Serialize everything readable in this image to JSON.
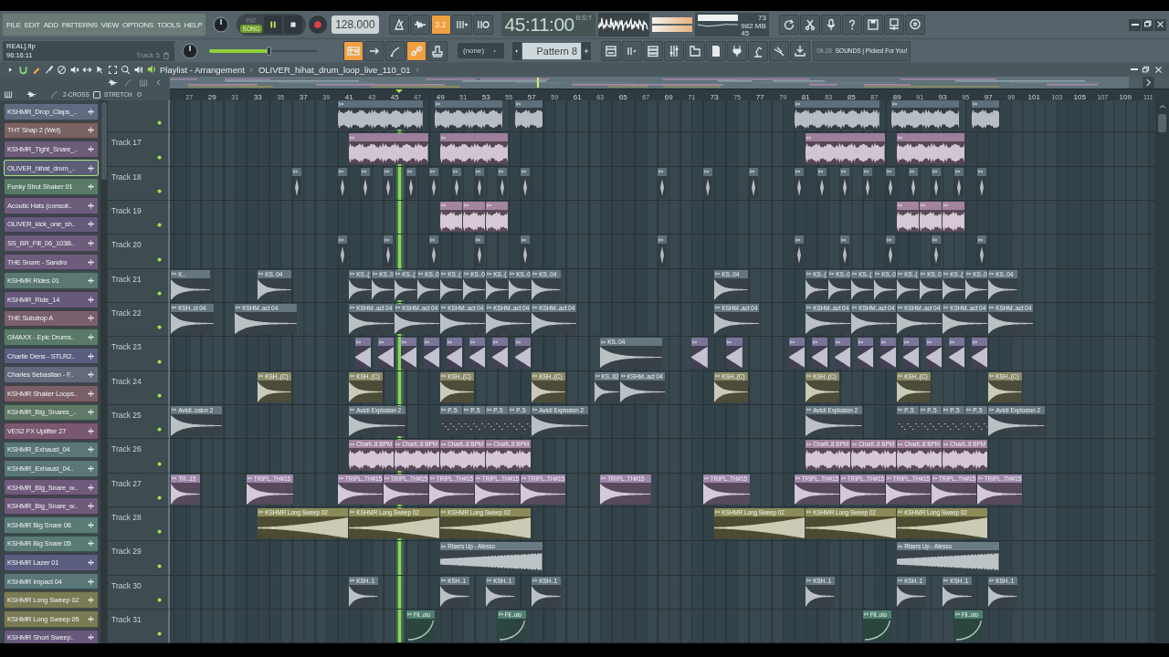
{
  "menu": [
    "FILE",
    "EDIT",
    "ADD",
    "PATTERNS",
    "VIEW",
    "OPTIONS",
    "TOOLS",
    "HELP"
  ],
  "modes": [
    {
      "label": "PAT",
      "selected": false
    },
    {
      "label": "SONG",
      "selected": true
    }
  ],
  "transport": {
    "playing": true
  },
  "tempo": "128.000",
  "tools_top": [
    {
      "kind": "metronome",
      "on": false
    },
    {
      "kind": "wave",
      "on": false
    },
    {
      "kind": "text",
      "label": "3.2",
      "on": true
    },
    {
      "kind": "step",
      "on": false
    },
    {
      "kind": "loop",
      "on": false
    }
  ],
  "time": {
    "value": "45:11:00",
    "unit": "B:S:T"
  },
  "stats": {
    "cpu": "73",
    "memory": "982 MB",
    "polyphony": "45"
  },
  "file": {
    "name": "REAL].flp",
    "time": "96:16:11",
    "hint": "Track 5"
  },
  "master": {
    "level": 0.55
  },
  "tools_bottom": [
    {
      "kind": "playlist",
      "on": true
    },
    {
      "kind": "arrow",
      "on": false
    },
    {
      "kind": "curve",
      "on": false
    },
    {
      "kind": "link",
      "on": true
    },
    {
      "kind": "stamp",
      "on": false
    }
  ],
  "arrangement": "(none)",
  "pattern": "Pattern 8",
  "news": {
    "date": "09-28",
    "text": "SOUNDS | Picked For You!"
  },
  "playlist": {
    "title": "Playlist - Arrangement",
    "clip": "OLIVER_hihat_drum_loop_live_110_01",
    "cross": "2-CROSS",
    "cross_checked": false,
    "stretch": "STRETCH"
  },
  "ruler": [
    "27",
    "29",
    "31",
    "33",
    "35",
    "37",
    "39",
    "41",
    "43",
    "45",
    "47",
    "49",
    "51",
    "53",
    "55",
    "57",
    "59",
    "61",
    "63",
    "65",
    "67",
    "69",
    "71",
    "73",
    "75",
    "77",
    "79",
    "81",
    "83",
    "85",
    "87",
    "89",
    "91",
    "93",
    "95",
    "97",
    "99",
    "101",
    "103",
    "105",
    "107",
    "109",
    "111"
  ],
  "channels": [
    {
      "name": "KSHMR_Drop_Claps_..",
      "color": "#5e6b80",
      "selected": false
    },
    {
      "name": "THT Snap 2 (Wet)",
      "color": "#7b6262",
      "selected": false
    },
    {
      "name": "KSHMR_Tight_Snare_..",
      "color": "#6b5c78",
      "selected": false
    },
    {
      "name": "OLIVER_hihat_drum_..",
      "color": "#5c5e78",
      "selected": true
    },
    {
      "name": "Funky Strut Shaker 01",
      "color": "#587a67",
      "selected": false
    },
    {
      "name": "Acoutic Hats (consoli..",
      "color": "#6d5c7c",
      "selected": false
    },
    {
      "name": "OLIVER_kick_one_sh..",
      "color": "#665a7c",
      "selected": false
    },
    {
      "name": "SS_BR_Fill_06_103B..",
      "color": "#6d5c7c",
      "selected": false
    },
    {
      "name": "THE Snare - Sandro",
      "color": "#6d5c7c",
      "selected": false
    },
    {
      "name": "KSHMR Rides 01",
      "color": "#5a7770",
      "selected": false
    },
    {
      "name": "KSHMR_Ride_14",
      "color": "#66597a",
      "selected": false
    },
    {
      "name": "THE Subdrop A",
      "color": "#7a5f6c",
      "selected": false
    },
    {
      "name": "GMAXX - Epic Drums..",
      "color": "#587a67",
      "selected": false
    },
    {
      "name": "Charlie Dens - STLR2..",
      "color": "#5c5e80",
      "selected": false
    },
    {
      "name": "Charles Sebastian - F..",
      "color": "#626a7c",
      "selected": false
    },
    {
      "name": "KSHMR Shaker Loops..",
      "color": "#7a5f66",
      "selected": false
    },
    {
      "name": "KSHMR_Big_Snares_..",
      "color": "#5f7a66",
      "selected": false
    },
    {
      "name": "VES2 FX Uplifter 27",
      "color": "#7a5870",
      "selected": false
    },
    {
      "name": "KSHMR_Exhaust_04",
      "color": "#5a7676",
      "selected": false
    },
    {
      "name": "KSHMR_Exhaust_04..",
      "color": "#5a7676",
      "selected": false
    },
    {
      "name": "KSHMR_Big_Snare_w..",
      "color": "#6f5a7c",
      "selected": false
    },
    {
      "name": "KSHMR_Big_Snare_w..",
      "color": "#6f5a7c",
      "selected": false
    },
    {
      "name": "KSHMR Big Snare 06",
      "color": "#5a7a76",
      "selected": false
    },
    {
      "name": "KSHMR Big Snare 05",
      "color": "#5a7a76",
      "selected": false
    },
    {
      "name": "KSHMR Lazer 01",
      "color": "#5c5e80",
      "selected": false
    },
    {
      "name": "KSHMR Impact 04",
      "color": "#5a7676",
      "selected": false
    },
    {
      "name": "KSHMR Long Sweep 02",
      "color": "#7a7a55",
      "selected": false
    },
    {
      "name": "KSHMR Long Sweep 05",
      "color": "#7a7a55",
      "selected": false
    },
    {
      "name": "KSHMR Short Sweep..",
      "color": "#66597a",
      "selected": false
    }
  ],
  "tracks": [
    {
      "active": true,
      "clips": [
        {
          "kind": "loop"
        },
        {
          "kind": "loop"
        },
        {
          "kind": "loop"
        },
        {
          "kind": "loop"
        },
        {
          "kind": "loop"
        },
        {
          "kind": "loop"
        }
      ]
    },
    {
      "label": "Track 17",
      "active": true,
      "color": "#9c7f9a",
      "clips": [
        {
          "kind": "loop"
        },
        {
          "kind": "loop"
        },
        {
          "kind": "loop"
        },
        {
          "kind": "loop"
        }
      ]
    },
    {
      "label": "Track 18",
      "active": true,
      "color": "#5f6f79",
      "clips": [
        {
          "kind": "tick"
        },
        {
          "kind": "tick"
        },
        {
          "kind": "tick"
        },
        {
          "kind": "tick"
        },
        {
          "kind": "tick"
        },
        {
          "kind": "tick"
        },
        {
          "kind": "tick"
        },
        {
          "kind": "tick"
        },
        {
          "kind": "tick"
        },
        {
          "kind": "tick"
        },
        {
          "kind": "tick"
        },
        {
          "kind": "tick"
        },
        {
          "kind": "tick"
        },
        {
          "kind": "tick"
        },
        {
          "kind": "tick"
        },
        {
          "kind": "tick"
        },
        {
          "kind": "tick"
        },
        {
          "kind": "tick"
        },
        {
          "kind": "tick"
        },
        {
          "kind": "tick"
        },
        {
          "kind": "tick"
        },
        {
          "kind": "tick"
        }
      ]
    },
    {
      "label": "Track 19",
      "active": true,
      "color": "#a4849f",
      "clips": [
        {
          "kind": "loop"
        },
        {
          "kind": "loop"
        },
        {
          "kind": "loop"
        },
        {
          "kind": "loop"
        },
        {
          "kind": "loop"
        },
        {
          "kind": "loop"
        }
      ]
    },
    {
      "label": "Track 20",
      "active": true,
      "color": "#5f6f79",
      "clips": [
        {
          "kind": "tick"
        },
        {
          "kind": "tick"
        },
        {
          "kind": "tick"
        },
        {
          "kind": "tick"
        },
        {
          "kind": "tick"
        },
        {
          "kind": "tick"
        },
        {
          "kind": "tick"
        },
        {
          "kind": "tick"
        },
        {
          "kind": "tick"
        },
        {
          "kind": "tick"
        },
        {
          "kind": "tick"
        }
      ]
    },
    {
      "label": "Track 21",
      "active": true,
      "color": "#66767f",
      "clips": [
        {
          "kind": "hit",
          "label": "K.."
        },
        {
          "kind": "hit",
          "label": "KS..04"
        },
        {
          "kind": "hit",
          "label": "KS..("
        },
        {
          "kind": "hit",
          "label": "KS..0"
        },
        {
          "kind": "hit",
          "label": "KS..("
        },
        {
          "kind": "hit",
          "label": "KS..0"
        },
        {
          "kind": "hit",
          "label": "KS..("
        },
        {
          "kind": "hit",
          "label": "KS..0"
        },
        {
          "kind": "hit",
          "label": "KS..("
        },
        {
          "kind": "hit",
          "label": "KS..0"
        },
        {
          "kind": "hit",
          "label": "KS..04"
        },
        {
          "kind": "hit",
          "label": "KS..04"
        },
        {
          "kind": "hit",
          "label": "KS..("
        },
        {
          "kind": "hit",
          "label": "KS..0"
        },
        {
          "kind": "hit",
          "label": "KS..("
        },
        {
          "kind": "hit",
          "label": "KS..0"
        },
        {
          "kind": "hit",
          "label": "KS..("
        },
        {
          "kind": "hit",
          "label": "KS..0"
        },
        {
          "kind": "hit",
          "label": "KS..("
        },
        {
          "kind": "hit",
          "label": "KS..0"
        },
        {
          "kind": "hit",
          "label": "KS..04"
        }
      ]
    },
    {
      "label": "Track 22",
      "active": true,
      "color": "#66767f",
      "clips": [
        {
          "kind": "hit",
          "label": "KSH..ct 04"
        },
        {
          "kind": "hit",
          "label": "KSHM..act 04"
        },
        {
          "kind": "hit",
          "label": "KSHM..act 04"
        },
        {
          "kind": "hit",
          "label": "KSHM..act 04"
        },
        {
          "kind": "hit",
          "label": "KSHM..act 04"
        },
        {
          "kind": "hit",
          "label": "KSHM..act 04"
        },
        {
          "kind": "hit",
          "label": "KSHM..act 04"
        },
        {
          "kind": "hit",
          "label": "KSHM..act 04"
        },
        {
          "kind": "hit",
          "label": "KSHM..act 04"
        },
        {
          "kind": "hit",
          "label": "KSHM..act 04"
        },
        {
          "kind": "hit",
          "label": "KSHM..act 04"
        },
        {
          "kind": "hit",
          "label": "KSHM..act 04"
        },
        {
          "kind": "hit",
          "label": "KSHM..act 04"
        }
      ]
    },
    {
      "label": "Track 23",
      "active": true,
      "color": "#7b7599",
      "clips": [
        {
          "kind": "reverse"
        },
        {
          "kind": "reverse"
        },
        {
          "kind": "reverse"
        },
        {
          "kind": "reverse"
        },
        {
          "kind": "reverse"
        },
        {
          "kind": "reverse"
        },
        {
          "kind": "reverse"
        },
        {
          "kind": "reverse"
        },
        {
          "kind": "hit",
          "label": "KS..04",
          "color": "#66767f"
        },
        {
          "kind": "reverse"
        },
        {
          "kind": "reverse"
        },
        {
          "kind": "reverse"
        },
        {
          "kind": "reverse"
        },
        {
          "kind": "reverse"
        },
        {
          "kind": "reverse"
        },
        {
          "kind": "reverse"
        },
        {
          "kind": "reverse"
        },
        {
          "kind": "reverse"
        },
        {
          "kind": "reverse"
        },
        {
          "kind": "reverse"
        }
      ]
    },
    {
      "label": "Track 24",
      "active": true,
      "color": "#8a8a68",
      "clips": [
        {
          "kind": "hit",
          "label": "KSH..(C)"
        },
        {
          "kind": "hit",
          "label": "KSH..(C)"
        },
        {
          "kind": "hit",
          "label": "KSH..(C)"
        },
        {
          "kind": "hit",
          "label": "KSH..(C)"
        },
        {
          "kind": "hit",
          "label": "KS..82",
          "color": "#66767f"
        },
        {
          "kind": "hit",
          "label": "KSHM..act 04",
          "color": "#66767f"
        },
        {
          "kind": "hit",
          "label": "KSH..(C)"
        },
        {
          "kind": "hit",
          "label": "KSH..(C)"
        },
        {
          "kind": "hit",
          "label": "KSH..(C)"
        },
        {
          "kind": "hit",
          "label": "KSH..(C)"
        }
      ]
    },
    {
      "label": "Track 25",
      "active": true,
      "color": "#66767f",
      "clips": [
        {
          "kind": "hit",
          "label": "Avicii..osion 2"
        },
        {
          "kind": "hit",
          "label": "Avicii Explosion 2"
        },
        {
          "kind": "pattern",
          "label": "P..5"
        },
        {
          "kind": "pattern",
          "label": "P..5"
        },
        {
          "kind": "pattern",
          "label": "P..5"
        },
        {
          "kind": "pattern",
          "label": "P..5"
        },
        {
          "kind": "hit",
          "label": "Avicii Explosion 2"
        },
        {
          "kind": "hit",
          "label": "Avicii Explosion 2"
        },
        {
          "kind": "pattern",
          "label": "P..5"
        },
        {
          "kind": "pattern",
          "label": "P..5"
        },
        {
          "kind": "pattern",
          "label": "P..5"
        },
        {
          "kind": "pattern",
          "label": "P..5"
        },
        {
          "kind": "hit",
          "label": "Avicii Explosion 2"
        }
      ]
    },
    {
      "label": "Track 26",
      "active": true,
      "color": "#a2829e",
      "clips": [
        {
          "kind": "loop",
          "label": "Charli..8 BPM"
        },
        {
          "kind": "loop",
          "label": "Charli..8 BPM"
        },
        {
          "kind": "loop",
          "label": "Charli..8 BPM"
        },
        {
          "kind": "loop",
          "label": "Charli..8 BPM"
        },
        {
          "kind": "loop",
          "label": "Charli..8 BPM"
        },
        {
          "kind": "loop",
          "label": "Charli..8 BPM"
        },
        {
          "kind": "loop",
          "label": "Charli..8 BPM"
        },
        {
          "kind": "loop",
          "label": "Charli..8 BPM"
        }
      ]
    },
    {
      "label": "Track 27",
      "active": true,
      "color": "#9d86a8",
      "clips": [
        {
          "kind": "hit",
          "label": "TR..15"
        },
        {
          "kind": "hit",
          "label": "TRIPL..TH#15"
        },
        {
          "kind": "hit",
          "label": "TRIPL..TH#15"
        },
        {
          "kind": "hit",
          "label": "TRIPL..TH#15"
        },
        {
          "kind": "hit",
          "label": "TRIPL..TH#15"
        },
        {
          "kind": "hit",
          "label": "TRIPL..TH#15"
        },
        {
          "kind": "hit",
          "label": "TRIPL..TH#15"
        },
        {
          "kind": "hit",
          "label": "TRIPL..TH#15"
        },
        {
          "kind": "hit",
          "label": "TRIPL..TH#15"
        },
        {
          "kind": "hit",
          "label": "TRIPL..TH#15"
        },
        {
          "kind": "hit",
          "label": "TRIPL..TH#15"
        },
        {
          "kind": "hit",
          "label": "TRIPL..TH#15"
        },
        {
          "kind": "hit",
          "label": "TRIPL..TH#15"
        },
        {
          "kind": "hit",
          "label": "TRIPL..TH#15"
        }
      ]
    },
    {
      "label": "Track 28",
      "active": true,
      "color": "#8c8b58",
      "clips": [
        {
          "kind": "sweep",
          "label": "KSHMR Long Sweep 02"
        },
        {
          "kind": "sweep",
          "label": "KSHMR Long Sweep 02"
        },
        {
          "kind": "sweep",
          "label": "KSHMR Long Sweep 02"
        },
        {
          "kind": "sweep",
          "label": "KSHMR Long Sweep 02"
        },
        {
          "kind": "sweep",
          "label": "KSHMR Long Sweep 02"
        },
        {
          "kind": "sweep",
          "label": "KSHMR Long Sweep 02"
        }
      ]
    },
    {
      "label": "Track 29",
      "active": true,
      "color": "#6b7b85",
      "clips": [
        {
          "kind": "riser",
          "label": "Risers Up - Alesso"
        },
        {
          "kind": "riser",
          "label": "Risers Up - Alesso"
        }
      ]
    },
    {
      "label": "Track 30",
      "active": true,
      "color": "#66767f",
      "clips": [
        {
          "kind": "hit",
          "label": "KSH..1"
        },
        {
          "kind": "hit",
          "label": "KSH..1"
        },
        {
          "kind": "hit",
          "label": "KSH..1"
        },
        {
          "kind": "hit",
          "label": "KSH..1"
        },
        {
          "kind": "hit",
          "label": "KSH..1"
        },
        {
          "kind": "hit",
          "label": "KSH..1"
        },
        {
          "kind": "hit",
          "label": "KSH..1"
        },
        {
          "kind": "hit",
          "label": "KSH..1"
        }
      ]
    },
    {
      "label": "Track 31",
      "active": true,
      "color": "#4f7f70",
      "clips": [
        {
          "kind": "automation",
          "label": "Fil..olo"
        },
        {
          "kind": "automation",
          "label": "Fil..olo"
        },
        {
          "kind": "automation",
          "label": "Fil..olo"
        },
        {
          "kind": "automation",
          "label": "Fil..olo"
        }
      ]
    }
  ]
}
